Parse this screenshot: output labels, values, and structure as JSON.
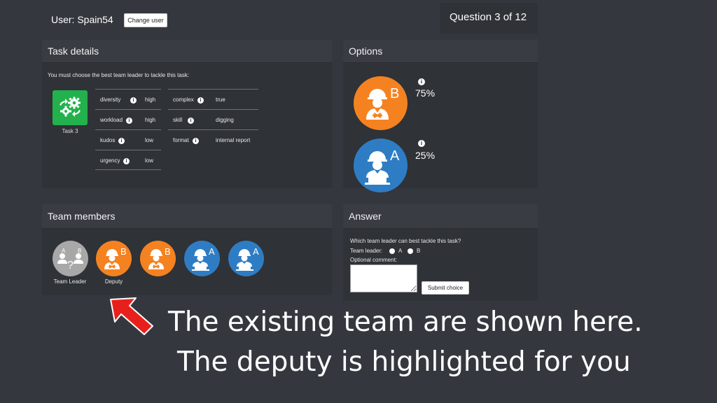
{
  "header": {
    "user_label": "User: Spain54",
    "change_user_label": "Change user",
    "question_progress": "Question 3 of 12"
  },
  "task_details": {
    "title": "Task details",
    "instruction": "You must choose the best team leader to tackle this task:",
    "task_label": "Task 3",
    "attributes_left": [
      {
        "key": "diversity",
        "value": "high"
      },
      {
        "key": "workload",
        "value": "high"
      },
      {
        "key": "kudos",
        "value": "low"
      },
      {
        "key": "urgency",
        "value": "low"
      }
    ],
    "attributes_right": [
      {
        "key": "complex",
        "value": "true"
      },
      {
        "key": "skill",
        "value": "digging"
      },
      {
        "key": "format",
        "value": "internal report"
      }
    ]
  },
  "options": {
    "title": "Options",
    "items": [
      {
        "letter": "B",
        "percent": "75%",
        "color": "#f58220"
      },
      {
        "letter": "A",
        "percent": "25%",
        "color": "#2e7dc4"
      }
    ]
  },
  "team_members": {
    "title": "Team members",
    "leader_label": "Team Leader",
    "deputy_label": "Deputy",
    "members": [
      {
        "letter": "B",
        "color": "#f58220"
      },
      {
        "letter": "B",
        "color": "#f58220"
      },
      {
        "letter": "A",
        "color": "#2e7dc4"
      },
      {
        "letter": "A",
        "color": "#2e7dc4"
      }
    ],
    "placeholder": {
      "letter_a": "A",
      "letter_b": "B",
      "question_mark": "?"
    }
  },
  "answer": {
    "title": "Answer",
    "question": "Which team leader can best tackle this task?",
    "team_leader_label": "Team leader:",
    "option_a": "A",
    "option_b": "B",
    "comment_label": "Optional comment:",
    "submit_label": "Submit choice"
  },
  "captions": {
    "line1": "The existing team are shown here.",
    "line2": "The deputy is highlighted for you"
  },
  "colors": {
    "background": "#34383e",
    "panel": "#2f3237",
    "orange": "#f58220",
    "blue": "#2e7dc4",
    "task_green": "#22b14c",
    "arrow_red": "#e8201c"
  }
}
